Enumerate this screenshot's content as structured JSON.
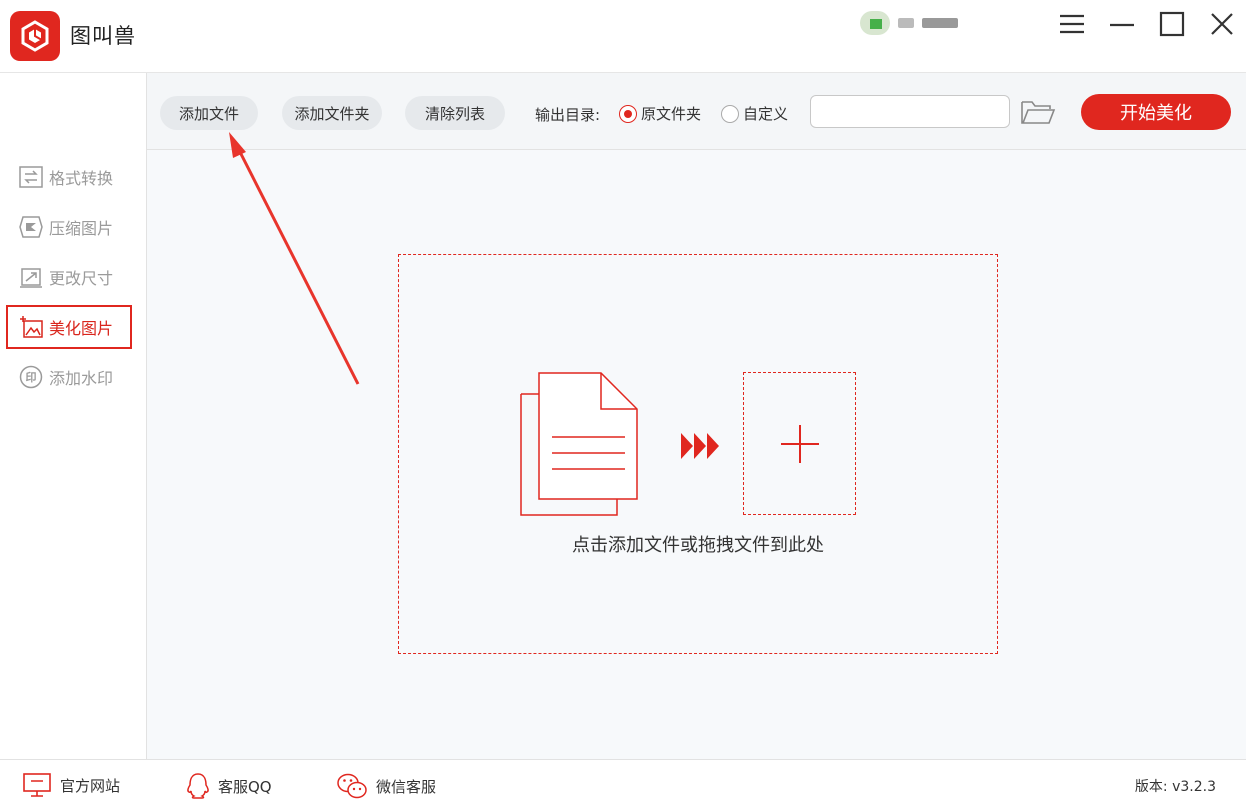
{
  "app": {
    "title": "图叫兽",
    "accent": "#e0271f"
  },
  "user": {
    "avatar": "avatar-icon"
  },
  "window_controls": [
    "menu-icon",
    "minimize-icon",
    "maximize-icon",
    "close-icon"
  ],
  "sidebar": {
    "items": [
      {
        "label": "格式转换",
        "icon": "convert-icon",
        "active": false
      },
      {
        "label": "压缩图片",
        "icon": "compress-icon",
        "active": false
      },
      {
        "label": "更改尺寸",
        "icon": "resize-icon",
        "active": false
      },
      {
        "label": "美化图片",
        "icon": "beautify-icon",
        "active": true
      },
      {
        "label": "添加水印",
        "icon": "watermark-icon",
        "active": false
      }
    ]
  },
  "toolbar": {
    "add_file": "添加文件",
    "add_folder": "添加文件夹",
    "clear_list": "清除列表",
    "output_label": "输出目录:",
    "radio_original": "原文件夹",
    "radio_custom": "自定义",
    "selected_output": "原文件夹",
    "path_value": "",
    "start": "开始美化"
  },
  "main": {
    "drop_hint": "点击添加文件或拖拽文件到此处"
  },
  "footer": {
    "website": "官方网站",
    "qq": "客服QQ",
    "wechat": "微信客服",
    "version": "版本: v3.2.3"
  }
}
